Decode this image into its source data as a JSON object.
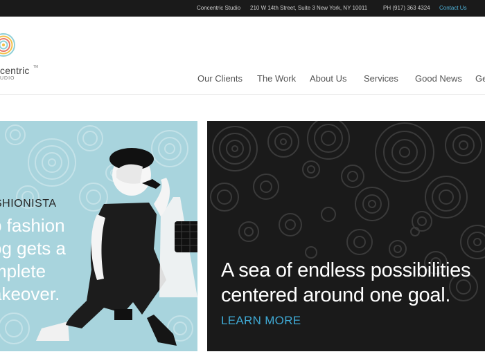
{
  "topbar": {
    "studio": "Concentric Studio",
    "address": "210 W 14th Street, Suite 3 New York, NY 10011",
    "phone": "PH (917) 363 4324",
    "contact_label": "Contact Us"
  },
  "logo": {
    "text": "centric",
    "trademark": "TM",
    "subtext": "UDIO"
  },
  "nav": {
    "items": [
      "Our Clients",
      "The Work",
      "About Us",
      "Services",
      "Good News",
      "Ge"
    ]
  },
  "hero_left": {
    "eyebrow": "SHIONISTA",
    "headline": [
      "p fashion",
      "og gets a",
      "mplete",
      "akeover."
    ]
  },
  "hero_right": {
    "tagline": [
      "A sea of endless possibilities",
      "centered around one goal."
    ],
    "cta": "LEARN MORE"
  },
  "colors": {
    "topbar": "#1a1a1a",
    "accent": "#3fa9d4",
    "hero_left_bg": "#a8d4dd",
    "hero_right_bg": "#1a1a1a"
  }
}
